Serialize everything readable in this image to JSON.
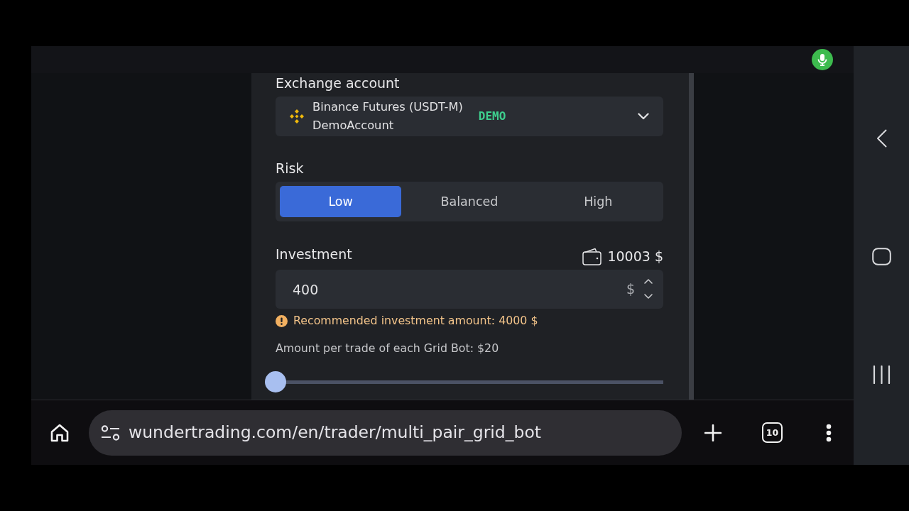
{
  "modal": {
    "exchange_account": {
      "label": "Exchange account",
      "exchange": "Binance Futures (USDT-M)",
      "account": "DemoAccount",
      "badge": "DEMO"
    },
    "risk": {
      "label": "Risk",
      "options": [
        {
          "label": "Low",
          "selected": true
        },
        {
          "label": "Balanced",
          "selected": false
        },
        {
          "label": "High",
          "selected": false
        }
      ]
    },
    "investment": {
      "label": "Investment",
      "balance": "10003 $",
      "value": "400",
      "currency": "$"
    },
    "warning": "Recommended investment amount: 4000 $",
    "amount_per_trade": "Amount per trade of each Grid Bot: $20",
    "slider": {
      "level": 0
    }
  },
  "browser_bar": {
    "url": "wundertrading.com/en/trader/multi_pair_grid_bot",
    "tab_count": "10"
  }
}
